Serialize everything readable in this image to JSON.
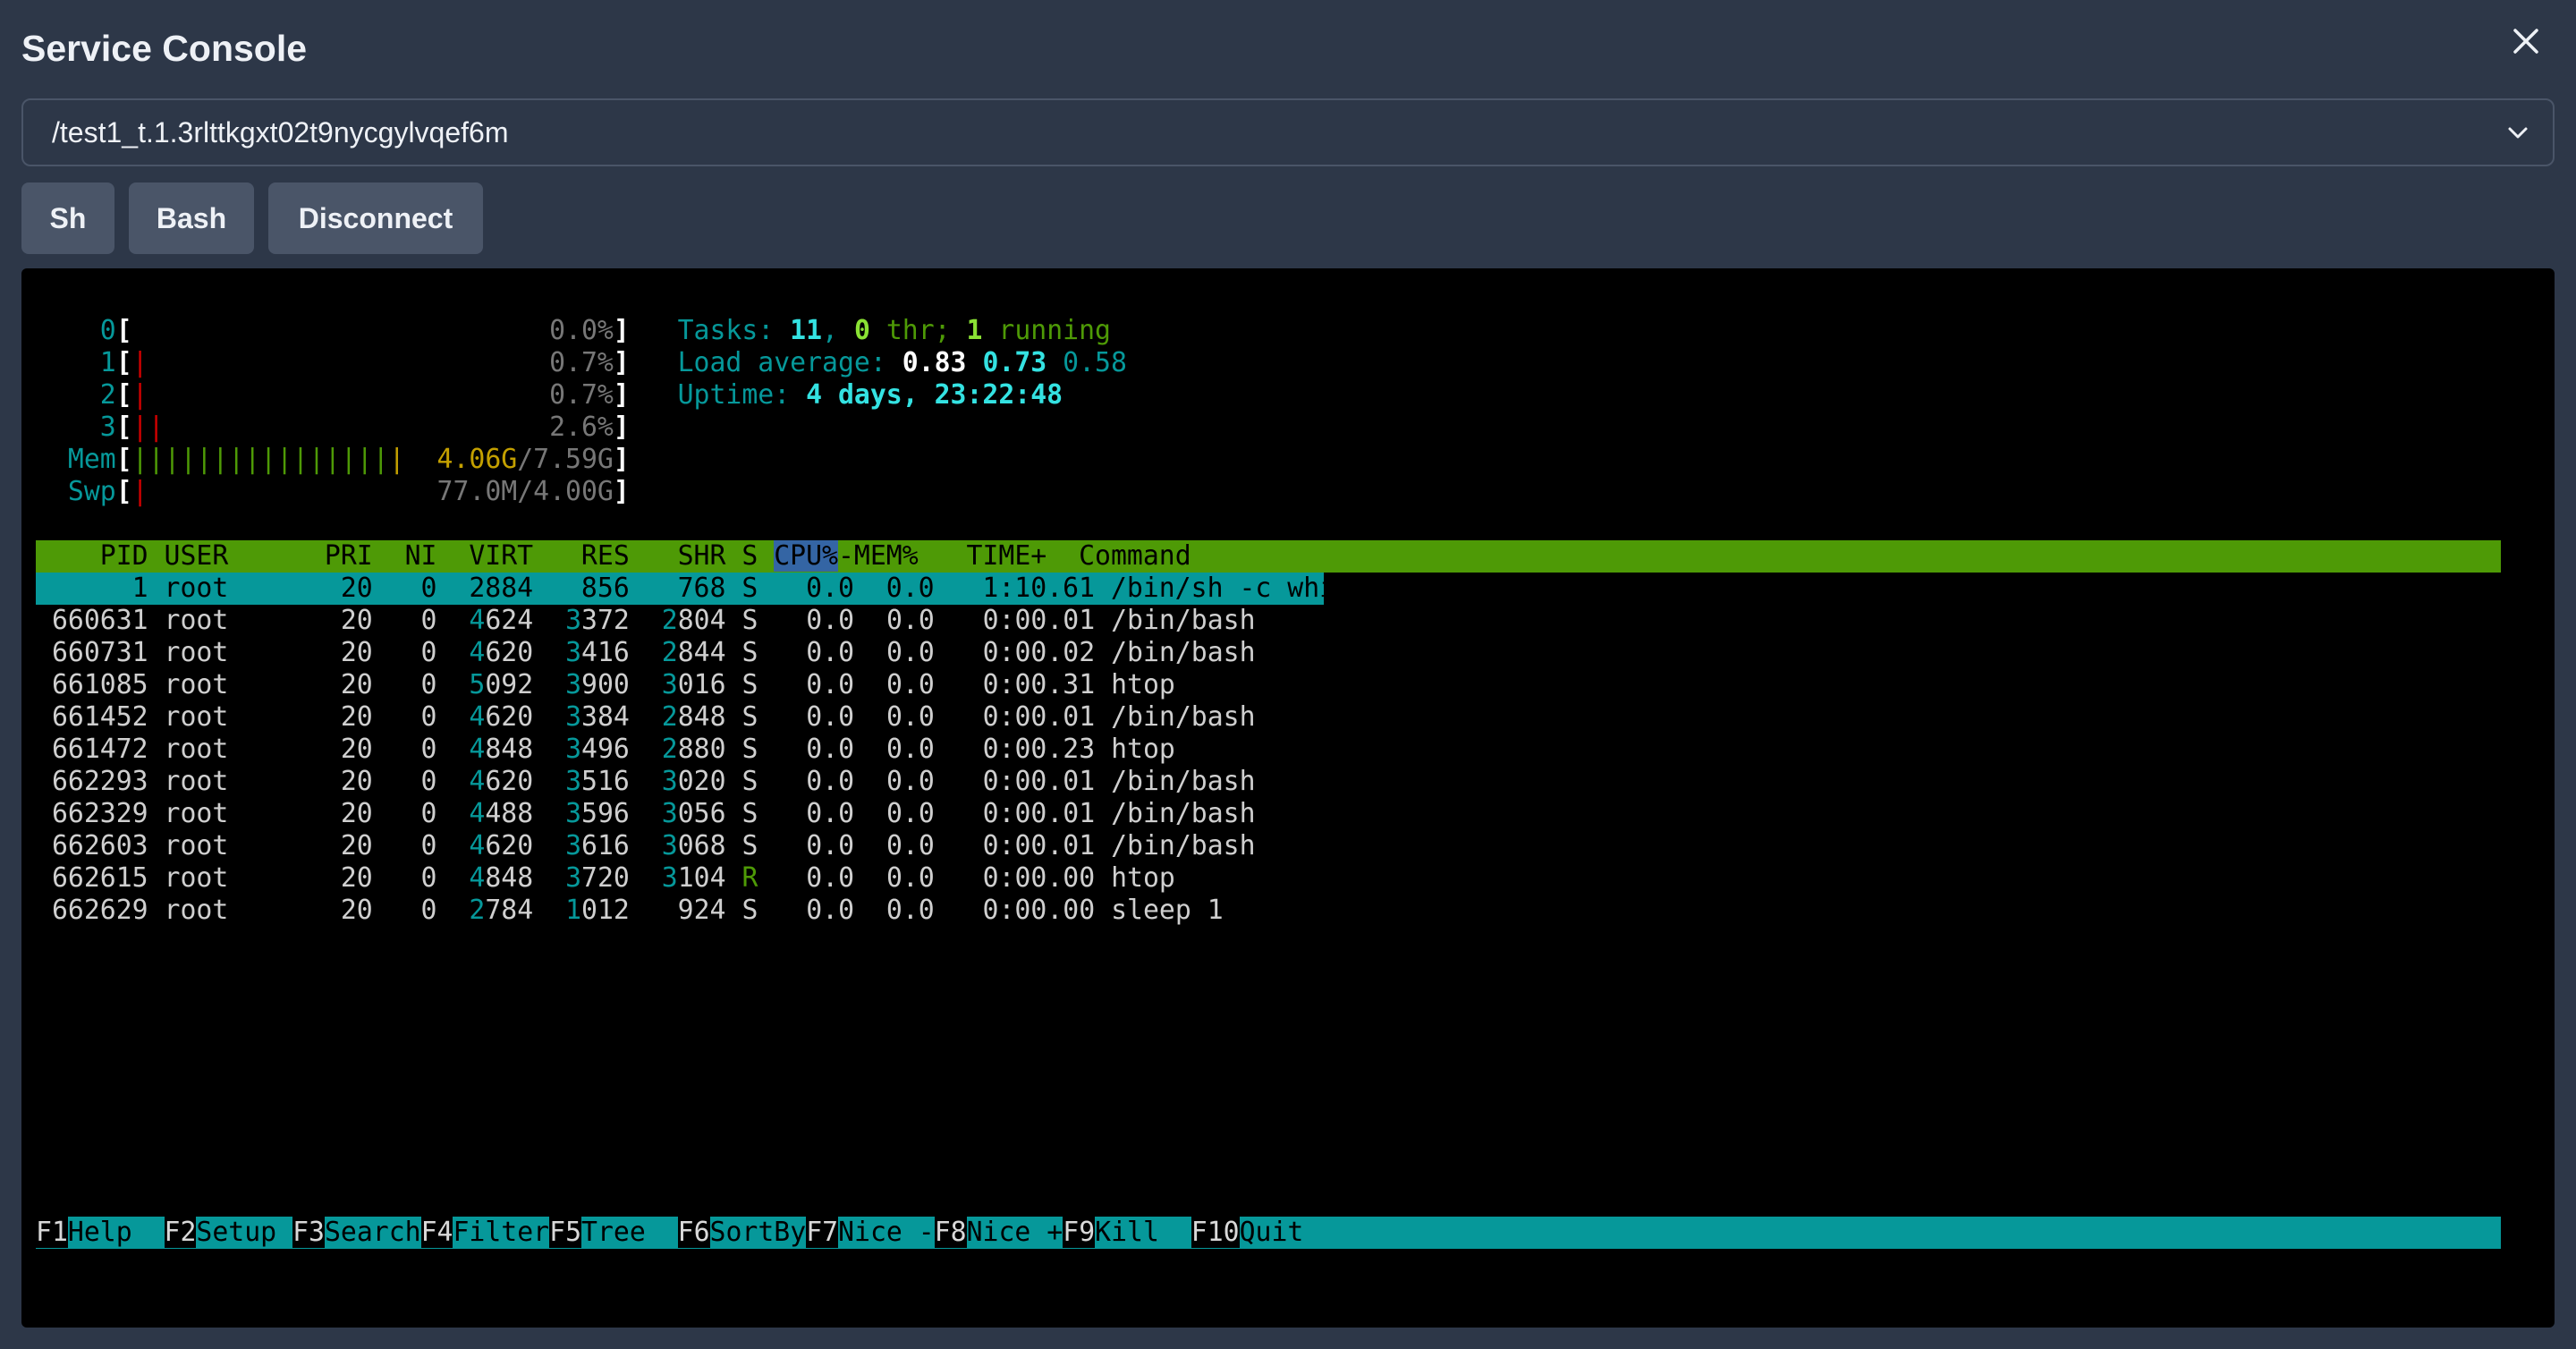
{
  "window": {
    "title": "Service Console"
  },
  "selector": {
    "value": "/test1_t.1.3rlttkgxt02t9nycgylvqef6m"
  },
  "buttons": {
    "sh": "Sh",
    "bash": "Bash",
    "disconnect": "Disconnect"
  },
  "htop": {
    "cpu": [
      {
        "id": "0",
        "bars": "",
        "pct": "0.0%"
      },
      {
        "id": "1",
        "bars": "|",
        "pct": "0.7%"
      },
      {
        "id": "2",
        "bars": "|",
        "pct": "0.7%"
      },
      {
        "id": "3",
        "bars": "||",
        "pct": "2.6%"
      }
    ],
    "mem": {
      "label": "Mem",
      "bars": "|||||||||||||||||",
      "used": "4.06G",
      "total": "/7.59G"
    },
    "swp": {
      "label": "Swp",
      "bars": "|",
      "value": "77.0M/4.00G"
    },
    "tasks": {
      "label": "Tasks: ",
      "count": "11",
      "sep": ", ",
      "thr": "0",
      "thr_label": " thr; ",
      "running": "1",
      "running_label": " running"
    },
    "load": {
      "label": "Load average: ",
      "l1": "0.83",
      "l5": "0.73",
      "l15": "0.58"
    },
    "uptime": {
      "label": "Uptime: ",
      "value": "4 days, 23:22:48"
    },
    "columns": [
      "PID",
      "USER",
      "PRI",
      "NI",
      "VIRT",
      "RES",
      "SHR",
      "S",
      "CPU%",
      "MEM%",
      "TIME+",
      "Command"
    ],
    "processes": [
      {
        "pid": "1",
        "user": "root",
        "pri": "20",
        "ni": "0",
        "virt": "2884",
        "res": "856",
        "shr": "768",
        "s": "S",
        "cpu": "0.0",
        "mem": "0.0",
        "time": "1:10.61",
        "cmd": "/bin/sh -c whil"
      },
      {
        "pid": "660631",
        "user": "root",
        "pri": "20",
        "ni": "0",
        "virt": "4624",
        "res": "3372",
        "shr": "2804",
        "s": "S",
        "cpu": "0.0",
        "mem": "0.0",
        "time": "0:00.01",
        "cmd": "/bin/bash"
      },
      {
        "pid": "660731",
        "user": "root",
        "pri": "20",
        "ni": "0",
        "virt": "4620",
        "res": "3416",
        "shr": "2844",
        "s": "S",
        "cpu": "0.0",
        "mem": "0.0",
        "time": "0:00.02",
        "cmd": "/bin/bash"
      },
      {
        "pid": "661085",
        "user": "root",
        "pri": "20",
        "ni": "0",
        "virt": "5092",
        "res": "3900",
        "shr": "3016",
        "s": "S",
        "cpu": "0.0",
        "mem": "0.0",
        "time": "0:00.31",
        "cmd": "htop"
      },
      {
        "pid": "661452",
        "user": "root",
        "pri": "20",
        "ni": "0",
        "virt": "4620",
        "res": "3384",
        "shr": "2848",
        "s": "S",
        "cpu": "0.0",
        "mem": "0.0",
        "time": "0:00.01",
        "cmd": "/bin/bash"
      },
      {
        "pid": "661472",
        "user": "root",
        "pri": "20",
        "ni": "0",
        "virt": "4848",
        "res": "3496",
        "shr": "2880",
        "s": "S",
        "cpu": "0.0",
        "mem": "0.0",
        "time": "0:00.23",
        "cmd": "htop"
      },
      {
        "pid": "662293",
        "user": "root",
        "pri": "20",
        "ni": "0",
        "virt": "4620",
        "res": "3516",
        "shr": "3020",
        "s": "S",
        "cpu": "0.0",
        "mem": "0.0",
        "time": "0:00.01",
        "cmd": "/bin/bash"
      },
      {
        "pid": "662329",
        "user": "root",
        "pri": "20",
        "ni": "0",
        "virt": "4488",
        "res": "3596",
        "shr": "3056",
        "s": "S",
        "cpu": "0.0",
        "mem": "0.0",
        "time": "0:00.01",
        "cmd": "/bin/bash"
      },
      {
        "pid": "662603",
        "user": "root",
        "pri": "20",
        "ni": "0",
        "virt": "4620",
        "res": "3616",
        "shr": "3068",
        "s": "S",
        "cpu": "0.0",
        "mem": "0.0",
        "time": "0:00.01",
        "cmd": "/bin/bash"
      },
      {
        "pid": "662615",
        "user": "root",
        "pri": "20",
        "ni": "0",
        "virt": "4848",
        "res": "3720",
        "shr": "3104",
        "s": "R",
        "cpu": "0.0",
        "mem": "0.0",
        "time": "0:00.00",
        "cmd": "htop"
      },
      {
        "pid": "662629",
        "user": "root",
        "pri": "20",
        "ni": "0",
        "virt": "2784",
        "res": "1012",
        "shr": "924",
        "s": "S",
        "cpu": "0.0",
        "mem": "0.0",
        "time": "0:00.00",
        "cmd": "sleep 1"
      }
    ],
    "fkeys": [
      {
        "key": "F1",
        "label": "Help  "
      },
      {
        "key": "F2",
        "label": "Setup "
      },
      {
        "key": "F3",
        "label": "Search"
      },
      {
        "key": "F4",
        "label": "Filter"
      },
      {
        "key": "F5",
        "label": "Tree  "
      },
      {
        "key": "F6",
        "label": "SortBy"
      },
      {
        "key": "F7",
        "label": "Nice -"
      },
      {
        "key": "F8",
        "label": "Nice +"
      },
      {
        "key": "F9",
        "label": "Kill  "
      },
      {
        "key": "F10",
        "label": "Quit"
      }
    ]
  },
  "icons": {
    "close": "close-icon",
    "dropdown": "chevron-down-icon"
  },
  "colors": {
    "modal_bg": "#2d3748",
    "control_bg": "#4a5568",
    "terminal_bg": "#000000",
    "header_bar": "#4e9a06",
    "selection_bar": "#06989a",
    "cyan": "#06989a"
  }
}
